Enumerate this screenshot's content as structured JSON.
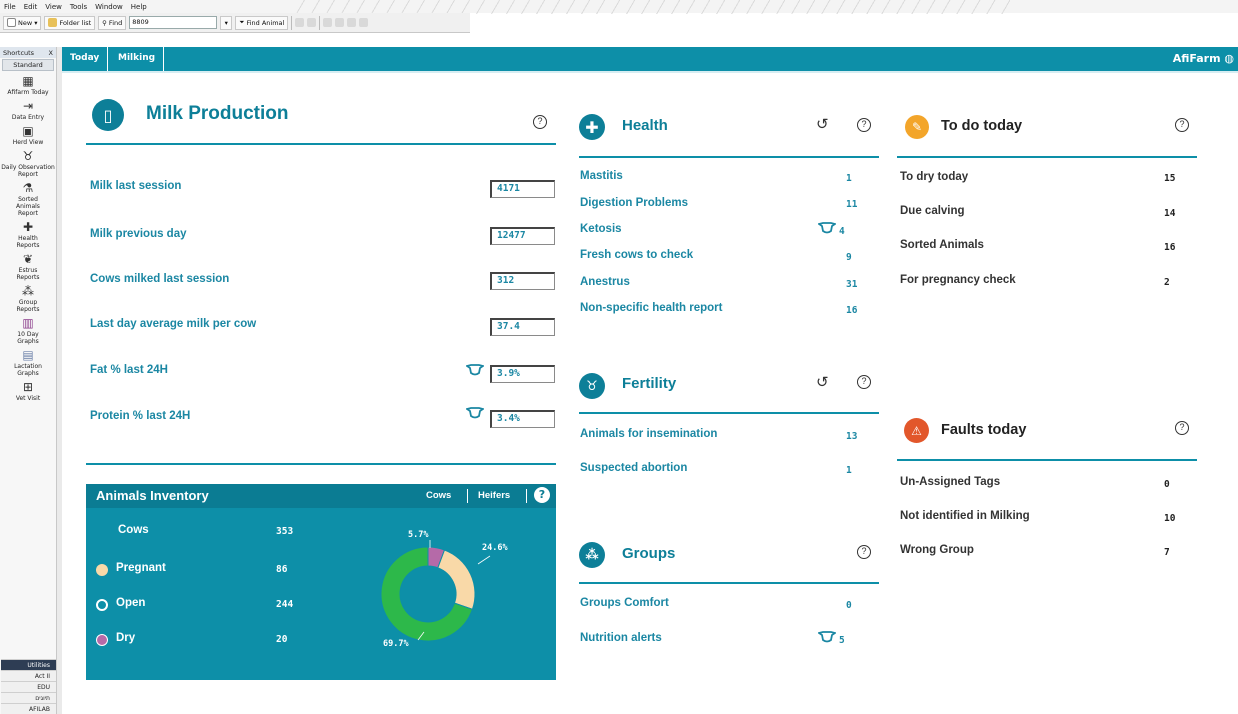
{
  "menu": [
    "File",
    "Edit",
    "View",
    "Tools",
    "Window",
    "Help"
  ],
  "toolbar": {
    "new_label": "New",
    "folder_label": "Folder list",
    "find_label": "Find",
    "find_value": "8809",
    "find_animal_label": "Find Animal"
  },
  "sidebar": {
    "header": "Shortcuts",
    "close_glyph": "X",
    "standard": "Standard",
    "items": [
      {
        "label": "Afifarm Today",
        "icon": "calendar-icon"
      },
      {
        "label": "Data Entry",
        "icon": "data-entry-icon"
      },
      {
        "label": "Herd View",
        "icon": "herd-view-icon"
      },
      {
        "label": "Daily Observation Report",
        "icon": "cow-head-icon"
      },
      {
        "label": "Sorted Animals Report",
        "icon": "sort-icon"
      },
      {
        "label": "Health Reports",
        "icon": "health-icon"
      },
      {
        "label": "Estrus Reports",
        "icon": "estrus-icon"
      },
      {
        "label": "Group Reports",
        "icon": "group-icon"
      },
      {
        "label": "10 Day Graphs",
        "icon": "bar-graph-icon"
      },
      {
        "label": "Lactation Graphs",
        "icon": "lactation-graph-icon"
      },
      {
        "label": "Vet Visit",
        "icon": "medical-bag-icon"
      }
    ],
    "bottom": [
      "Utilities",
      "Act II",
      "EDU",
      "תיוגים",
      "AFILAB"
    ]
  },
  "tabs": [
    "Today",
    "Milking"
  ],
  "brand": "AfiFarm",
  "milk": {
    "title": "Milk Production",
    "rows": [
      {
        "label": "Milk last session",
        "value": "4171"
      },
      {
        "label": "Milk previous day",
        "value": "12477"
      },
      {
        "label": "Cows milked last session",
        "value": "312"
      },
      {
        "label": "Last day average milk per cow",
        "value": "37.4"
      },
      {
        "label": "Fat % last 24H",
        "value": "3.9%"
      },
      {
        "label": "Protein % last 24H",
        "value": "3.4%"
      }
    ]
  },
  "health": {
    "title": "Health",
    "rows": [
      {
        "label": "Mastitis",
        "value": "1"
      },
      {
        "label": "Digestion Problems",
        "value": "11"
      },
      {
        "label": "Ketosis",
        "value": "4"
      },
      {
        "label": "Fresh cows to check",
        "value": "9"
      },
      {
        "label": "Anestrus",
        "value": "31"
      },
      {
        "label": "Non-specific health report",
        "value": "16"
      }
    ]
  },
  "fertility": {
    "title": "Fertility",
    "rows": [
      {
        "label": "Animals for insemination",
        "value": "13"
      },
      {
        "label": "Suspected abortion",
        "value": "1"
      }
    ]
  },
  "groups": {
    "title": "Groups",
    "rows": [
      {
        "label": "Groups Comfort",
        "value": "0"
      },
      {
        "label": "Nutrition alerts",
        "value": "5"
      }
    ]
  },
  "todo": {
    "title": "To do today",
    "rows": [
      {
        "label": "To dry today",
        "value": "15"
      },
      {
        "label": "Due calving",
        "value": "14"
      },
      {
        "label": "Sorted Animals",
        "value": "16"
      },
      {
        "label": "For pregnancy check",
        "value": "2"
      }
    ]
  },
  "faults": {
    "title": "Faults today",
    "rows": [
      {
        "label": "Un-Assigned Tags",
        "value": "0"
      },
      {
        "label": "Not identified in Milking",
        "value": "10"
      },
      {
        "label": "Wrong Group",
        "value": "7"
      }
    ]
  },
  "inventory": {
    "title": "Animals Inventory",
    "tab_cows": "Cows",
    "tab_heifers": "Heifers",
    "help": "?",
    "total_label": "Cows",
    "total_value": "353",
    "rows": [
      {
        "label": "Pregnant",
        "value": "86",
        "color": "#f9d9a8"
      },
      {
        "label": "Open",
        "value": "244",
        "color": "#2db84a"
      },
      {
        "label": "Dry",
        "value": "20",
        "color": "#b56aa8"
      }
    ],
    "pct_labels": [
      "5.7%",
      "24.6%",
      "69.7%"
    ]
  },
  "colors": {
    "accent": "#0d8fa8",
    "label": "#1b87a3",
    "todo": "#f3a52a",
    "fault": "#e2572b"
  }
}
